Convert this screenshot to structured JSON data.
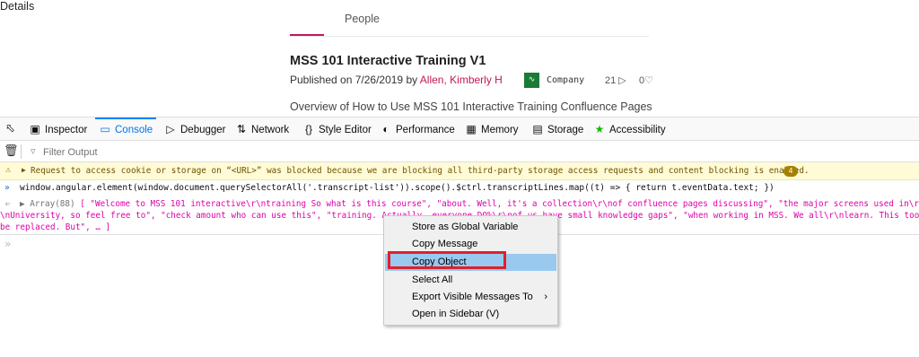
{
  "page": {
    "tabs": [
      "Details",
      "People"
    ],
    "title": "MSS 101 Interactive Training V1",
    "published_prefix": "Published on 7/26/2019 by ",
    "author": "Allen, Kimberly H",
    "company_icon": "people-icon",
    "company": "Company",
    "views": "21",
    "likes": "0",
    "overview": "Overview of How to Use MSS 101 Interactive Training Confluence Pages",
    "accent_color": "#c2185b"
  },
  "devtools": {
    "tools": [
      "Inspector",
      "Console",
      "Debugger",
      "Network",
      "Style Editor",
      "Performance",
      "Memory",
      "Storage",
      "Accessibility"
    ],
    "active_tool": "Console",
    "filter_placeholder": "Filter Output",
    "warning": {
      "text": "Request to access cookie or storage on “<URL>” was blocked because we are blocking all third-party storage access requests and content blocking is enabled.",
      "count": "4"
    },
    "command": "window.angular.element(window.document.querySelectorAll('.transcript-list')).scope().$ctrl.transcriptLines.map((t) => { return t.eventData.text; })",
    "result": {
      "prefix": "Array(88)",
      "line1": "[ \"Welcome to MSS 101 interactive\\r\\ntraining So what is this course\", \"about. Well, it's a collection\\r\\nof confluence pages discussing\", \"the major screens used in\\r\\nMadiso",
      "line2": "\\nUniversity, so feel free to\", \"check amount who can use this\", \"training. Actually, everyone DO%\\r\\nof us have small knowledge gaps\", \"when working in MSS. We all\\r\\nlearn. This tool th",
      "line3": "be replaced. But\", … ]"
    }
  },
  "context_menu": {
    "items": [
      "Store as Global Variable",
      "Copy Message",
      "Copy Object",
      "Select All",
      "Export Visible Messages To",
      "Open in Sidebar (V)"
    ],
    "highlighted": "Copy Object",
    "highlight_color": "#99c9ef",
    "annotation_color": "#e0202a"
  }
}
